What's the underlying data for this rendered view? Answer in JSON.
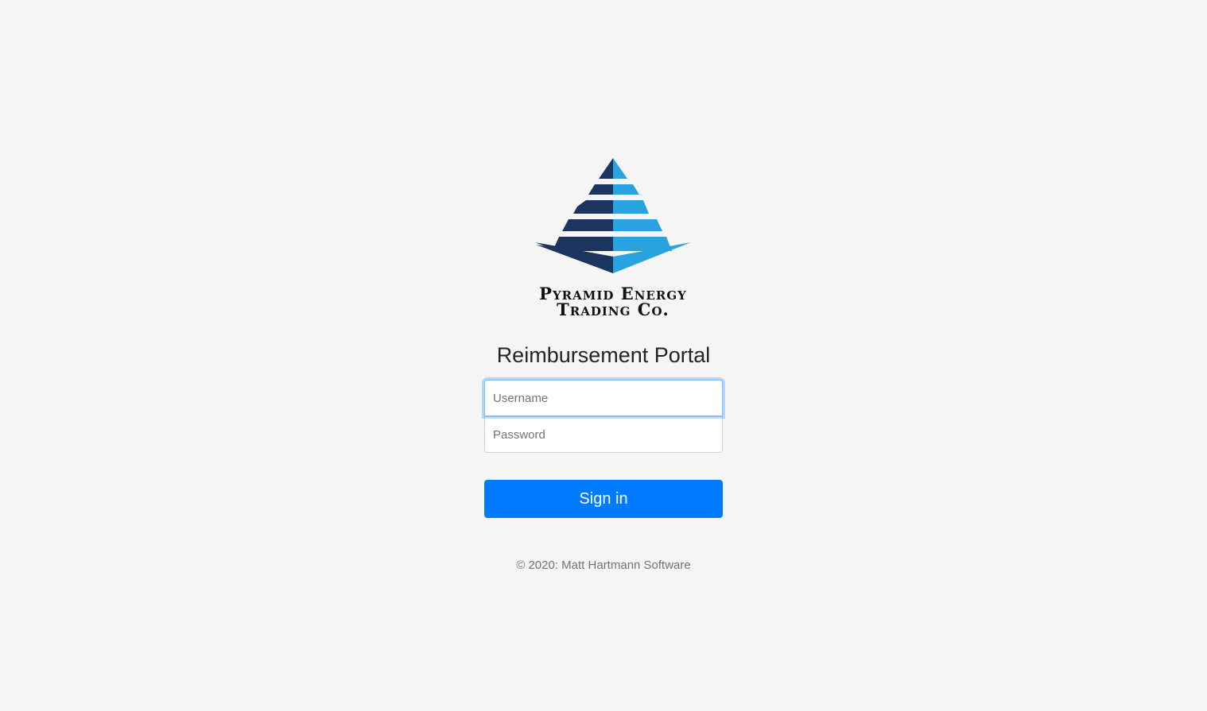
{
  "brand": {
    "name_line1": "Pyramid Energy",
    "name_line2": "Trading Co.",
    "logo_icon": "pyramid-logo-icon",
    "colors": {
      "dark": "#1b355e",
      "light": "#29a3e0"
    }
  },
  "page": {
    "title": "Reimbursement Portal"
  },
  "form": {
    "username": {
      "placeholder": "Username",
      "value": ""
    },
    "password": {
      "placeholder": "Password",
      "value": ""
    },
    "submit_label": "Sign in"
  },
  "footer": {
    "text": "© 2020: Matt Hartmann Software"
  },
  "colors": {
    "background": "#f5f5f5",
    "primary": "#007bff",
    "focus_ring": "#80bdff",
    "muted_text": "#6c757d"
  }
}
